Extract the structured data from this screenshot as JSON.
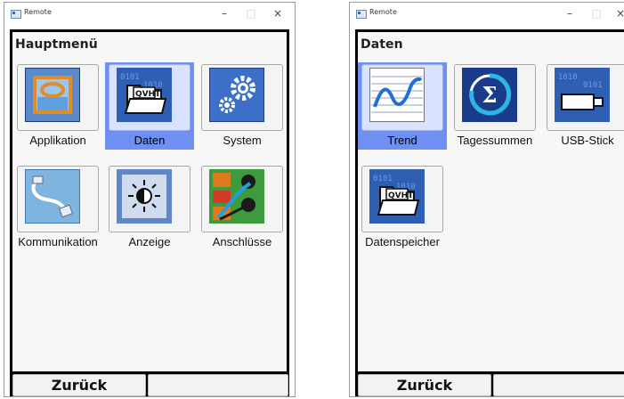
{
  "left": {
    "window_title": "Remote",
    "screen_title": "Hauptmenü",
    "tiles": [
      {
        "label": "Applikation",
        "icon": "applikation-icon"
      },
      {
        "label": "Daten",
        "icon": "daten-folder-icon",
        "selected": true
      },
      {
        "label": "System",
        "icon": "system-gears-icon"
      },
      {
        "label": "Kommunikation",
        "icon": "kommunikation-cable-icon"
      },
      {
        "label": "Anzeige",
        "icon": "anzeige-brightness-icon"
      },
      {
        "label": "Anschlüsse",
        "icon": "anschluesse-terminal-icon"
      }
    ],
    "softkeys": [
      "Zurück",
      ""
    ]
  },
  "right": {
    "window_title": "Remote",
    "screen_title": "Daten",
    "tiles": [
      {
        "label": "Trend",
        "icon": "trend-chart-icon",
        "selected": true
      },
      {
        "label": "Tagessummen",
        "icon": "sigma-icon"
      },
      {
        "label": "USB-Stick",
        "icon": "usb-stick-icon"
      },
      {
        "label": "Datenspeicher",
        "icon": "datenspeicher-folder-icon"
      }
    ],
    "softkeys": [
      "Zurück",
      ""
    ]
  },
  "window_buttons": {
    "minimize": "–",
    "maximize": "□",
    "close": "×"
  },
  "colors": {
    "selection": "#6f8ff2",
    "frame": "#000000",
    "screen_bg": "#f7f7f7"
  }
}
